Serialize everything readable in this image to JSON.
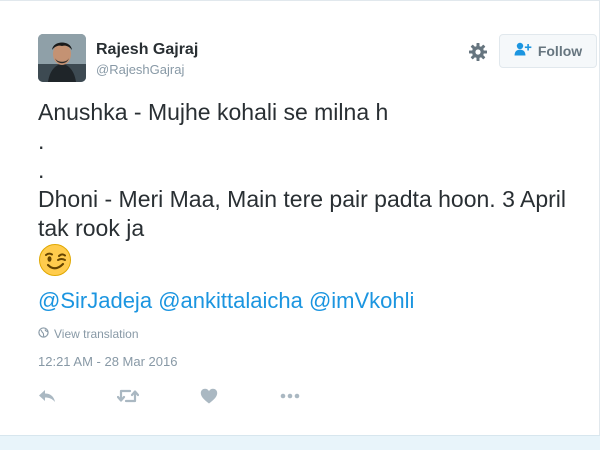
{
  "user": {
    "name": "Rajesh Gajraj",
    "handle": "@RajeshGajraj"
  },
  "follow_button": {
    "label": "Follow",
    "icon": "add-user-icon"
  },
  "settings_icon": "gear-icon",
  "tweet": {
    "lines": [
      "Anushka - Mujhe kohali se milna h",
      ".",
      ".",
      "Dhoni - Meri Maa, Main tere pair padta hoon. 3 April tak rook ja"
    ],
    "emoji": "winking-face",
    "mentions": [
      "@SirJadeja",
      "@ankittalaicha",
      "@imVkohli"
    ]
  },
  "view_translation": {
    "label": "View translation",
    "icon": "globe-icon"
  },
  "timestamp": "12:21 AM - 28 Mar 2016",
  "actions": [
    "reply-icon",
    "retweet-icon",
    "like-icon",
    "more-icon"
  ],
  "colors": {
    "link": "#1b95e0",
    "meta": "#8899a6",
    "text": "#292f33",
    "icon": "#aab8c2"
  }
}
